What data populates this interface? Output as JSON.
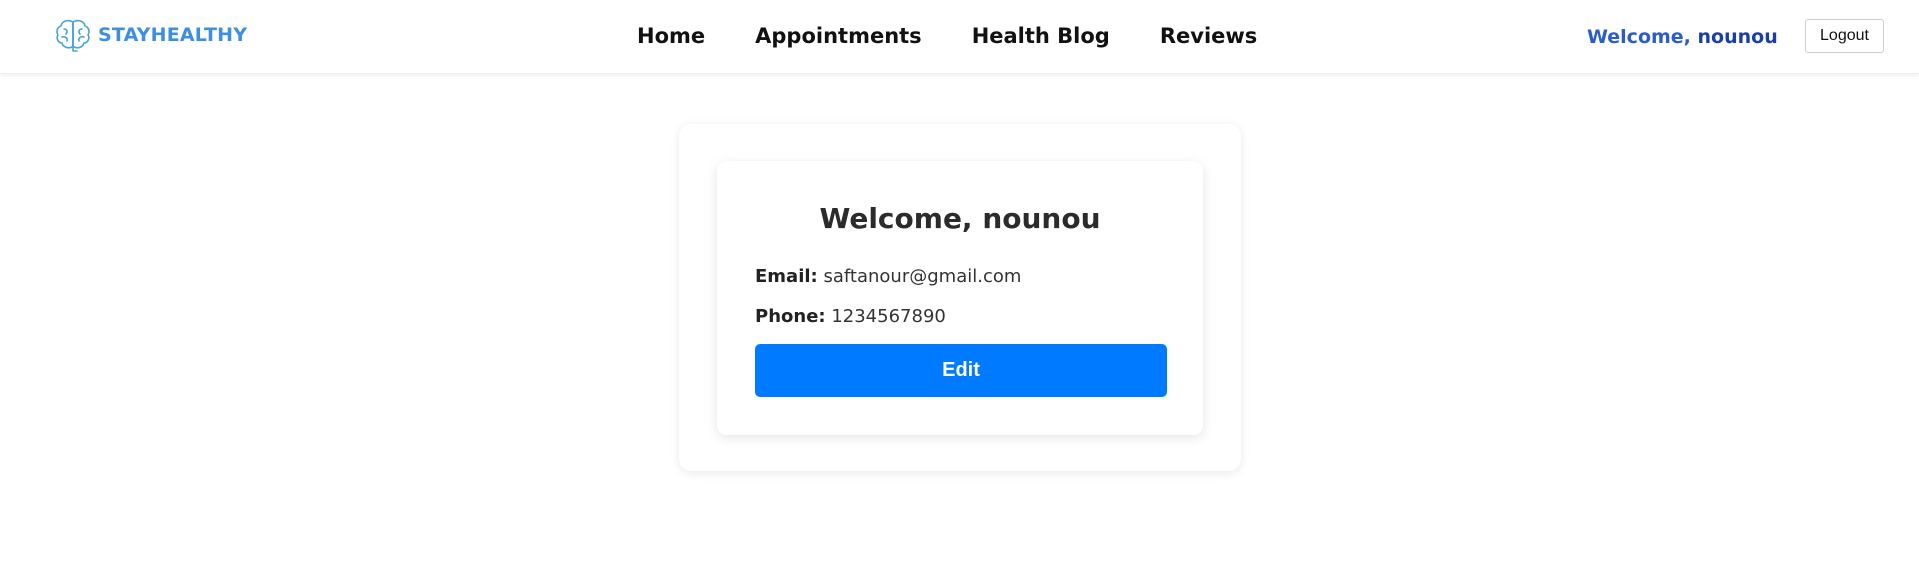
{
  "navbar": {
    "brand": {
      "name": "STAYHEALTHY",
      "icon": "brain-logo-icon"
    },
    "links": [
      {
        "label": "Home"
      },
      {
        "label": "Appointments"
      },
      {
        "label": "Health Blog"
      },
      {
        "label": "Reviews"
      }
    ],
    "welcome_prefix": "Welcome, ",
    "username": "nounou",
    "logout_label": "Logout"
  },
  "profile": {
    "title": "Welcome, nounou",
    "email_label": "Email:",
    "email_value": "saftanour@gmail.com",
    "phone_label": "Phone:",
    "phone_value": "1234567890",
    "edit_label": "Edit"
  },
  "colors": {
    "brand": "#3f8fe0",
    "welcome": "#2a5dc8",
    "primary_button": "#007bff"
  }
}
